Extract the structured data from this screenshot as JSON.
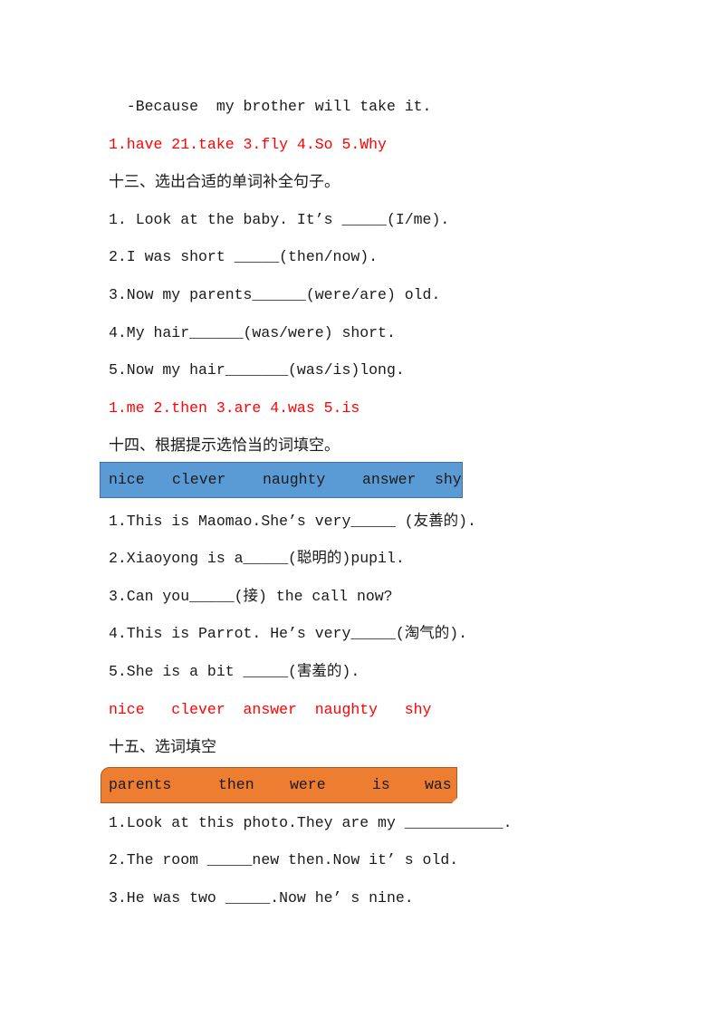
{
  "section12_tail": {
    "dialog_line": "  -Because  my brother will take it.",
    "answers": "1.have 21.take 3.fly 4.So 5.Why"
  },
  "section13": {
    "heading": "十三、选出合适的单词补全句子。",
    "questions": [
      "1. Look at the baby. It’s _____(I/me).",
      "2.I was short _____(then/now).",
      "3.Now my parents______(were/are) old.",
      "4.My hair______(was/were) short.",
      "5.Now my hair_______(was/is)long."
    ],
    "answers": "1.me 2.then 3.are 4.was 5.is"
  },
  "section14": {
    "heading": "十四、根据提示选恰当的词填空。",
    "word_bank": [
      "nice",
      "clever",
      "naughty",
      "answer",
      "shy"
    ],
    "word_bank_color": "#5b9bd5",
    "questions": [
      "1.This is Maomao.She’s very_____ (友善的).",
      "2.Xiaoyong is a_____(聪明的)pupil.",
      "3.Can you_____(接) the call now?",
      "4.This is Parrot. He’s very_____(淘气的).",
      "5.She is a bit _____(害羞的)."
    ],
    "answers": "nice   clever  answer  naughty   shy"
  },
  "section15": {
    "heading": "十五、选词填空",
    "word_bank": [
      "parents",
      "then",
      "were",
      "is",
      "was"
    ],
    "word_bank_color": "#ed7d31",
    "questions": [
      "1.Look at this photo.They are my ___________.",
      "2.The room _____new then.Now it’ s old.",
      "3.He was two _____.Now he’ s nine."
    ]
  },
  "colors": {
    "answer_text": "#ff0000",
    "body_text": "#1a1a1a"
  }
}
